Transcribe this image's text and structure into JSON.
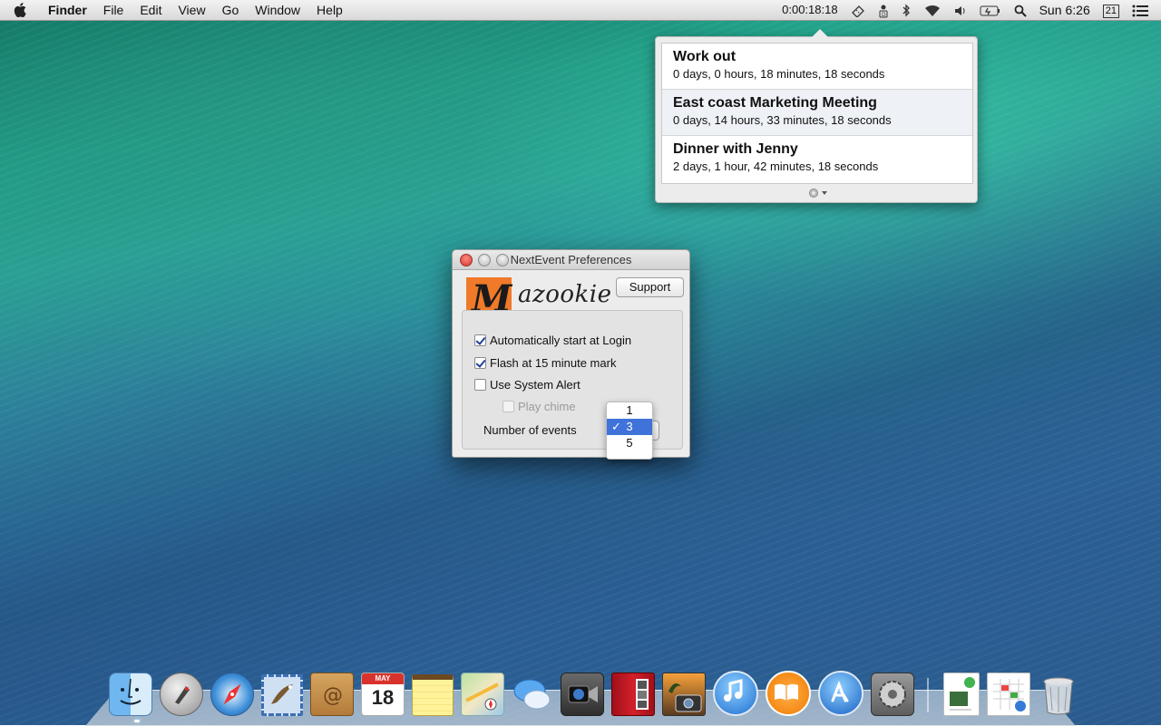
{
  "menubar": {
    "apple_icon": "apple-icon",
    "app_name": "Finder",
    "menus": [
      "File",
      "Edit",
      "View",
      "Go",
      "Window",
      "Help"
    ],
    "timer": "0:00:18:18",
    "day": "Sun",
    "time": "6:26",
    "calendar_day": "21"
  },
  "popover": {
    "events": [
      {
        "title": "Work out",
        "duration": "0 days, 0 hours, 18 minutes, 18 seconds"
      },
      {
        "title": "East coast Marketing Meeting",
        "duration": "0 days, 14 hours, 33 minutes, 18 seconds"
      },
      {
        "title": "Dinner with Jenny",
        "duration": "2 days, 1 hour, 42 minutes, 18 seconds"
      }
    ]
  },
  "prefs_window": {
    "title": "NextEvent Preferences",
    "logo_letter": "M",
    "logo_text": "azookie",
    "support_label": "Support",
    "options": {
      "auto_start": {
        "label": "Automatically start at Login",
        "checked": true
      },
      "flash": {
        "label": "Flash at 15 minute mark",
        "checked": true
      },
      "system_alert": {
        "label": "Use System Alert",
        "checked": false
      },
      "play_chime": {
        "label": "Play chime",
        "checked": false,
        "disabled": true
      }
    },
    "events_label": "Number of events",
    "events_options": [
      "1",
      "3",
      "5"
    ],
    "events_selected": "3",
    "check_mark": "✓"
  },
  "dock": {
    "items": [
      "Finder",
      "Launchpad",
      "Safari",
      "Mail",
      "Contacts",
      "Calendar",
      "Notes",
      "Maps",
      "Messages",
      "FaceTime",
      "Photo Booth",
      "iPhoto",
      "iTunes",
      "iBooks",
      "App Store",
      "System Preferences",
      "Preview",
      "Preferences document",
      "Trash"
    ],
    "calendar_month": "MAY",
    "calendar_date": "18",
    "colors": {
      "accent": "#3f73d9",
      "logo": "#f07a2a"
    }
  }
}
